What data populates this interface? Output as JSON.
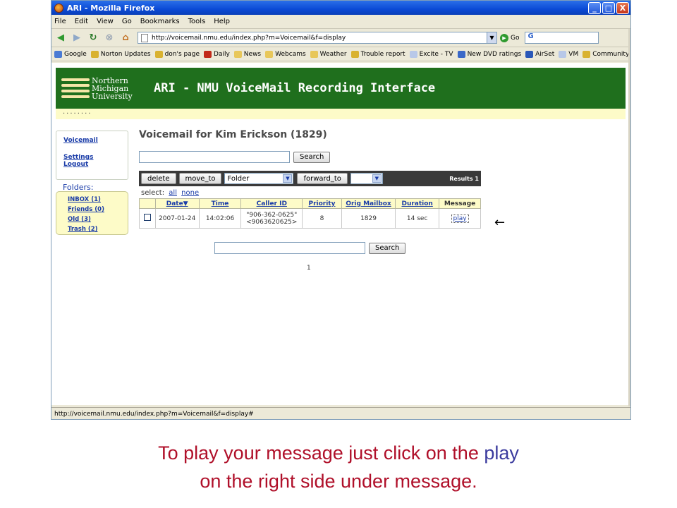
{
  "window": {
    "title": "ARI - Mozilla Firefox",
    "minimize": "_",
    "maximize": "□",
    "close": "X"
  },
  "menu": [
    "File",
    "Edit",
    "View",
    "Go",
    "Bookmarks",
    "Tools",
    "Help"
  ],
  "nav": {
    "url": "http://voicemail.nmu.edu/index.php?m=Voicemail&f=display",
    "go_label": "Go",
    "search_value": "G"
  },
  "bookmarks": [
    {
      "label": "Google",
      "color": "#4a7bd4"
    },
    {
      "label": "Norton Updates",
      "color": "#d9b230"
    },
    {
      "label": "don's page",
      "color": "#d9b230"
    },
    {
      "label": "Daily",
      "color": "#c22a1a"
    },
    {
      "label": "News",
      "color": "#e8c75a"
    },
    {
      "label": "Webcams",
      "color": "#e8c75a"
    },
    {
      "label": "Weather",
      "color": "#e8c75a"
    },
    {
      "label": "Trouble report",
      "color": "#d9b230"
    },
    {
      "label": "Excite - TV",
      "color": "#b8c8e8"
    },
    {
      "label": "New DVD ratings",
      "color": "#3a68c8"
    },
    {
      "label": "AirSet",
      "color": "#2a58b8"
    },
    {
      "label": "VM",
      "color": "#b8c8e8"
    },
    {
      "label": "Community for Avaya...",
      "color": "#d9b230"
    }
  ],
  "page": {
    "logo_lines": [
      "Northern",
      "Michigan",
      "University"
    ],
    "header_title": "ARI - NMU VoiceMail Recording Interface",
    "strip_dots": "........",
    "sidebar": {
      "voicemail": "Voicemail",
      "settings": "Settings",
      "logout": "Logout"
    },
    "folders_label": "Folders:",
    "folders": [
      "INBOX (1)",
      "Friends (0)",
      "Old (3)",
      "Trash (2)"
    ],
    "title": "Voicemail for Kim Erickson (1829)",
    "search_button": "Search",
    "toolbar": {
      "delete": "delete",
      "move_to": "move_to",
      "folder_select": "Folder",
      "forward_to": "forward_to",
      "forward_select": "",
      "results": "Results 1"
    },
    "select": {
      "label": "select:",
      "all": "all",
      "none": "none"
    },
    "table": {
      "headers": [
        "Date",
        "Time",
        "Caller ID",
        "Priority",
        "Orig Mailbox",
        "Duration",
        "Message"
      ],
      "rows": [
        {
          "date": "2007-01-24",
          "time": "14:02:06",
          "caller_line1": "\"906-362-0625\"",
          "caller_line2": "<9063620625>",
          "priority": "8",
          "mailbox": "1829",
          "duration": "14 sec",
          "message": "play"
        }
      ]
    },
    "arrow": "←",
    "page_number": "1"
  },
  "status": {
    "text": "http://voicemail.nmu.edu/index.php?m=Voicemail&f=display#"
  },
  "caption": {
    "part1": "To play your message just click on the ",
    "highlight": "play",
    "part2": "on the right side under message."
  }
}
